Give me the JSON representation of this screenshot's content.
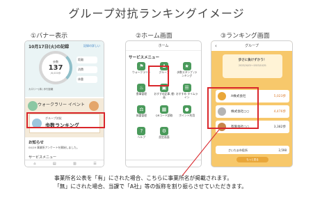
{
  "title": "グループ対抗ランキングイメージ",
  "sections": {
    "banner": "①バナー表示",
    "home": "②ホーム画面",
    "ranking": "③ランキング画面"
  },
  "phone1": {
    "date": "10月17日(火)の記録",
    "record_link": "記録の詳しい",
    "steps_label": "歩数",
    "steps": "137",
    "steps_goal": "/8,000歩",
    "side": [
      "距離",
      "消費",
      "体重"
    ],
    "calorie": "カロリー(体) 歩行距離",
    "event_title": "ウォークラリー イベント",
    "banner_line1": "グループ対抗",
    "banner_line2": "歩数ランキング",
    "notice_title": "お知らせ",
    "notice_row": "04/19 事業所アンケートを開始しました。",
    "service_menu": "サービスメニュー"
  },
  "phone2": {
    "header": "ホーム",
    "service_menu": "サービスメニュー",
    "items": [
      "ウォークラリー",
      "グループ",
      "歩数スタンプ /ランキング",
      "食事管理",
      "おすすめ記事 /動画",
      "おすすめ タイムライン",
      "体重管理",
      "QRコード読取",
      "ポイント利用",
      "ヘルプ",
      "設定画面",
      ""
    ]
  },
  "phone3": {
    "header": "グループ",
    "goal_title": "歩さに負けずかう！",
    "goal_sub": "2023/10/01〜2023/10/31",
    "ranks": [
      {
        "name": "A株式会社",
        "value": "5,023",
        "unit": "歩"
      },
      {
        "name": "株式会社○○",
        "value": "4,476",
        "unit": "歩"
      },
      {
        "name": "有限会社○○",
        "value": "3,382",
        "unit": "歩"
      }
    ],
    "mine_name": "さいたま市役所",
    "mine_value": "2,598",
    "more_button": "もっと見る"
  },
  "notes": {
    "line1": "事業所名公表を「有」にされた場合、こちらに事業所名が掲載されます。",
    "line2": "「無」にされた場合、当課で「A社」等の仮称を割り振らさせていただきます。"
  },
  "colors": {
    "highlight": "#d9262b",
    "ranking_bg": "#f7c86b",
    "accent_green": "#4a9a5b"
  }
}
